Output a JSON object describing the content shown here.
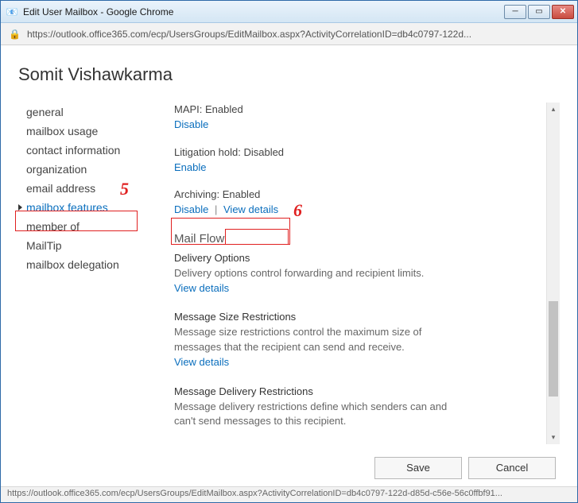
{
  "window": {
    "title": "Edit User Mailbox - Google Chrome"
  },
  "address": {
    "url": "https://outlook.office365.com/ecp/UsersGroups/EditMailbox.aspx?ActivityCorrelationID=db4c0797-122d..."
  },
  "page": {
    "title": "Somit Vishawkarma"
  },
  "nav": {
    "items": [
      {
        "label": "general"
      },
      {
        "label": "mailbox usage"
      },
      {
        "label": "contact information"
      },
      {
        "label": "organization"
      },
      {
        "label": "email address"
      },
      {
        "label": "mailbox features"
      },
      {
        "label": "member of"
      },
      {
        "label": "MailTip"
      },
      {
        "label": "mailbox delegation"
      }
    ],
    "activeIndex": 5
  },
  "features": {
    "mapi": {
      "label": "MAPI: Enabled",
      "action": "Disable"
    },
    "litigation": {
      "label": "Litigation hold: Disabled",
      "action": "Enable"
    },
    "archiving": {
      "label": "Archiving: Enabled",
      "action": "Disable",
      "details": "View details"
    }
  },
  "mailflow": {
    "heading": "Mail Flow",
    "delivery": {
      "title": "Delivery Options",
      "desc": "Delivery options control forwarding and recipient limits.",
      "link": "View details"
    },
    "size": {
      "title": "Message Size Restrictions",
      "desc": "Message size restrictions control the maximum size of messages that the recipient can send and receive.",
      "link": "View details"
    },
    "msgdelivery": {
      "title": "Message Delivery Restrictions",
      "desc": "Message delivery restrictions define which senders can and can't send messages to this recipient."
    }
  },
  "buttons": {
    "save": "Save",
    "cancel": "Cancel"
  },
  "status": "https://outlook.office365.com/ecp/UsersGroups/EditMailbox.aspx?ActivityCorrelationID=db4c0797-122d-d85d-c56e-56c0ffbf91...",
  "annotations": {
    "five": "5",
    "six": "6"
  }
}
